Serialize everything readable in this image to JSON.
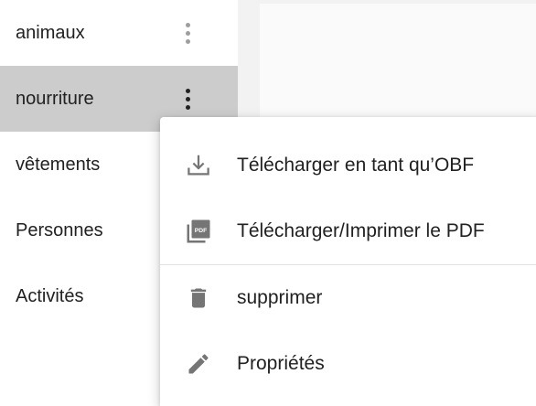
{
  "sidebar": {
    "items": [
      {
        "label": "animaux",
        "selected": false,
        "menu_icon": "more-vert-icon"
      },
      {
        "label": "nourriture",
        "selected": true,
        "menu_icon": "more-vert-icon"
      },
      {
        "label": "vêtements",
        "selected": false
      },
      {
        "label": "Personnes",
        "selected": false
      },
      {
        "label": "Activités",
        "selected": false
      }
    ]
  },
  "context_menu": {
    "items": [
      {
        "label": "Télécharger en tant qu’OBF",
        "icon": "download-icon"
      },
      {
        "label": "Télécharger/Imprimer le PDF",
        "icon": "pdf-icon"
      },
      {
        "label": "supprimer",
        "icon": "trash-icon"
      },
      {
        "label": "Propriétés",
        "icon": "pencil-icon"
      }
    ]
  },
  "colors": {
    "selected_bg": "#cccccc",
    "icon_gray": "#757575",
    "text": "#212121"
  }
}
